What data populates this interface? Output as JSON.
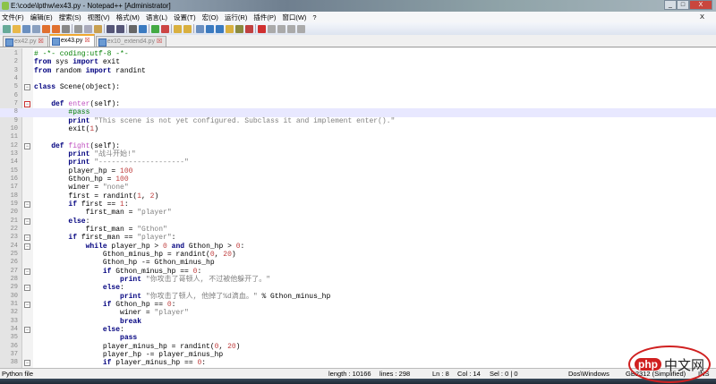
{
  "window": {
    "title": "E:\\code\\lpthw\\ex43.py - Notepad++ [Administrator]",
    "min": "_",
    "max": "□",
    "close": "X"
  },
  "menu": [
    "文件(F)",
    "编辑(E)",
    "搜索(S)",
    "视图(V)",
    "格式(M)",
    "语言(L)",
    "设置(T)",
    "宏(O)",
    "运行(R)",
    "插件(P)",
    "窗口(W)",
    "?"
  ],
  "menu_close": "X",
  "toolbar_icons": [
    "new-file-icon",
    "open-icon",
    "save-icon",
    "save-all-icon",
    "close-icon",
    "close-all-icon",
    "print-icon",
    "cut-icon",
    "copy-icon",
    "paste-icon",
    "undo-icon",
    "redo-icon",
    "find-icon",
    "replace-icon",
    "zoom-in-icon",
    "zoom-out-icon",
    "sync-v-icon",
    "sync-h-icon",
    "wrap-icon",
    "all-chars-icon",
    "indent-guide-icon",
    "udl-icon",
    "doc-map-icon",
    "function-list-icon",
    "record-macro-icon",
    "stop-macro-icon",
    "play-macro-icon",
    "run-macro-icon",
    "save-macro-icon"
  ],
  "tabs": [
    {
      "label": "ex42.py",
      "active": false
    },
    {
      "label": "ex43.py",
      "active": true
    },
    {
      "label": "ex10_extend4.py",
      "active": false
    }
  ],
  "editor": {
    "current_line": 8,
    "lines": [
      "# -*- coding:utf-8 -*-",
      "from sys import exit",
      "from random import randint",
      "",
      "class Scene(object):",
      "",
      "    def enter(self):",
      "        #pass",
      "        print \"This scene is not yet configured. Subclass it and implement enter().\"",
      "        exit(1)",
      "",
      "    def fight(self):",
      "        print \"战斗开始!\"",
      "        print \"--------------------\"",
      "        player_hp = 100",
      "        Gthon_hp = 100",
      "        winer = \"none\"",
      "        first = randint(1, 2)",
      "        if first == 1:",
      "            first_man = \"player\"",
      "        else:",
      "            first_man = \"Gthon\"",
      "        if first_man == \"player\":",
      "            while player_hp > 0 and Gthon_hp > 0:",
      "                Gthon_minus_hp = randint(0, 20)",
      "                Gthon_hp -= Gthon_minus_hp",
      "                if Gthon_minus_hp == 0:",
      "                    print \"你攻击了哥顿人, 不过被他躲开了。\"",
      "                else:",
      "                    print \"你攻击了顿人, 他掉了%d滴血。\" % Gthon_minus_hp",
      "                if Gthon_hp == 0:",
      "                    winer = \"player\"",
      "                    break",
      "                else:",
      "                    pass",
      "                player_minus_hp = randint(0, 20)",
      "                player_hp -= player_minus_hp",
      "                if player_minus_hp == 0:"
    ],
    "fold_lines": [
      5,
      7,
      12,
      19,
      21,
      23,
      24,
      27,
      29,
      31,
      34,
      38
    ]
  },
  "status": {
    "type": "Python file",
    "length": "length : 10166",
    "lines": "lines : 298",
    "ln": "Ln : 8",
    "col": "Col : 14",
    "sel": "Sel : 0 | 0",
    "eol": "Dos\\Windows",
    "encoding": "GB2312 (Simplified)",
    "mode": "INS"
  },
  "watermark": {
    "php": "php",
    "cn": "中文网"
  }
}
